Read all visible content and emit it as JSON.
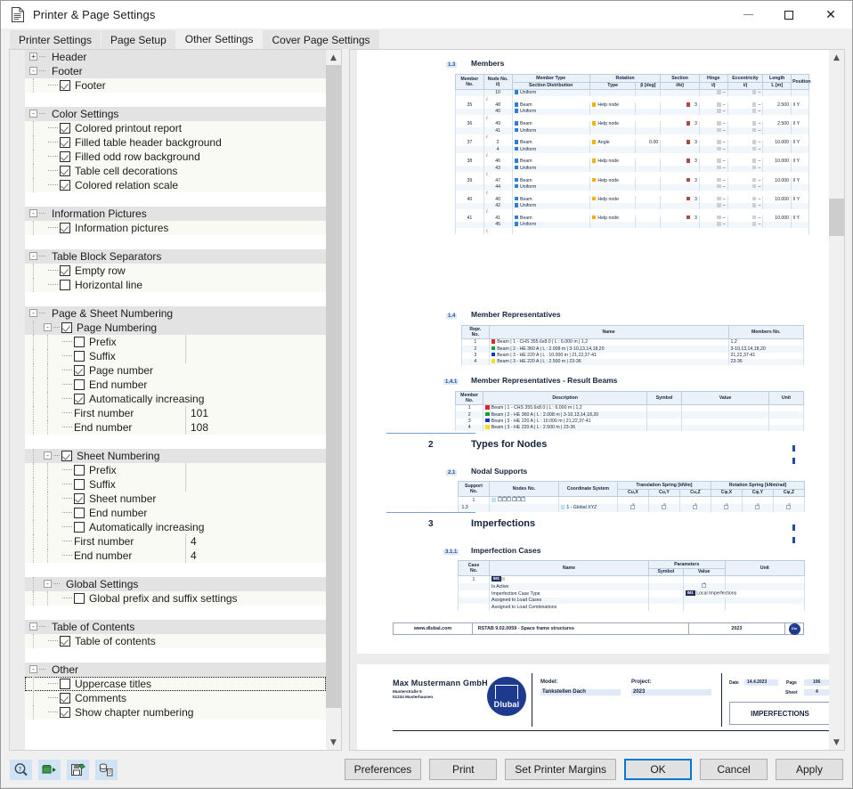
{
  "window": {
    "title": "Printer & Page Settings",
    "icon": "document-icon",
    "minimize": "minimize-icon",
    "maximize": "maximize-icon",
    "close": "close-icon"
  },
  "tabs": [
    {
      "label": "Printer Settings",
      "active": false
    },
    {
      "label": "Page Setup",
      "active": false
    },
    {
      "label": "Other Settings",
      "active": true
    },
    {
      "label": "Cover Page Settings",
      "active": false
    }
  ],
  "tree": {
    "rows": [
      {
        "kind": "group",
        "label": "Header",
        "expander": "+",
        "indent": 0
      },
      {
        "kind": "group",
        "label": "Footer",
        "expander": "-",
        "indent": 0
      },
      {
        "kind": "item",
        "label": "Footer",
        "checked": true,
        "indent": 2
      },
      {
        "kind": "blank"
      },
      {
        "kind": "group",
        "label": "Color Settings",
        "expander": "-",
        "indent": 0
      },
      {
        "kind": "item",
        "label": "Colored printout report",
        "checked": true,
        "indent": 2
      },
      {
        "kind": "item",
        "label": "Filled table header background",
        "checked": true,
        "indent": 2
      },
      {
        "kind": "item",
        "label": "Filled odd row background",
        "checked": true,
        "indent": 2
      },
      {
        "kind": "item",
        "label": "Table cell decorations",
        "checked": true,
        "indent": 2
      },
      {
        "kind": "item",
        "label": "Colored relation scale",
        "checked": true,
        "indent": 2
      },
      {
        "kind": "blank"
      },
      {
        "kind": "group",
        "label": "Information Pictures",
        "expander": "-",
        "indent": 0
      },
      {
        "kind": "item",
        "label": "Information pictures",
        "checked": true,
        "indent": 2
      },
      {
        "kind": "blank"
      },
      {
        "kind": "group",
        "label": "Table Block Separators",
        "expander": "-",
        "indent": 0
      },
      {
        "kind": "item",
        "label": "Empty row",
        "checked": true,
        "indent": 2
      },
      {
        "kind": "item",
        "label": "Horizontal line",
        "checked": false,
        "indent": 2
      },
      {
        "kind": "blank"
      },
      {
        "kind": "group",
        "label": "Page & Sheet Numbering",
        "expander": "-",
        "indent": 0
      },
      {
        "kind": "groupcb",
        "label": "Page Numbering",
        "checked": true,
        "expander": "-",
        "indent": 1
      },
      {
        "kind": "item",
        "label": "Prefix",
        "checked": false,
        "indent": 3,
        "hasvalue": true,
        "value": ""
      },
      {
        "kind": "item",
        "label": "Suffix",
        "checked": false,
        "indent": 3,
        "hasvalue": true,
        "value": ""
      },
      {
        "kind": "item",
        "label": "Page number",
        "checked": true,
        "indent": 3
      },
      {
        "kind": "item",
        "label": "End number",
        "checked": false,
        "indent": 3
      },
      {
        "kind": "item",
        "label": "Automatically increasing",
        "checked": true,
        "indent": 3
      },
      {
        "kind": "value",
        "label": "First number",
        "value": "101",
        "indent": 3
      },
      {
        "kind": "value",
        "label": "End number",
        "value": "108",
        "indent": 3
      },
      {
        "kind": "blank"
      },
      {
        "kind": "groupcb",
        "label": "Sheet Numbering",
        "checked": true,
        "expander": "-",
        "indent": 1
      },
      {
        "kind": "item",
        "label": "Prefix",
        "checked": false,
        "indent": 3,
        "hasvalue": true,
        "value": ""
      },
      {
        "kind": "item",
        "label": "Suffix",
        "checked": false,
        "indent": 3,
        "hasvalue": true,
        "value": ""
      },
      {
        "kind": "item",
        "label": "Sheet number",
        "checked": true,
        "indent": 3
      },
      {
        "kind": "item",
        "label": "End number",
        "checked": false,
        "indent": 3
      },
      {
        "kind": "item",
        "label": "Automatically increasing",
        "checked": false,
        "indent": 3
      },
      {
        "kind": "value",
        "label": "First number",
        "value": "4",
        "indent": 3
      },
      {
        "kind": "value",
        "label": "End number",
        "value": "4",
        "indent": 3
      },
      {
        "kind": "blank"
      },
      {
        "kind": "group",
        "label": "Global Settings",
        "expander": "-",
        "indent": 1
      },
      {
        "kind": "item",
        "label": "Global prefix and suffix settings",
        "checked": false,
        "indent": 3
      },
      {
        "kind": "blank"
      },
      {
        "kind": "group",
        "label": "Table of Contents",
        "expander": "-",
        "indent": 0
      },
      {
        "kind": "item",
        "label": "Table of contents",
        "checked": true,
        "indent": 2
      },
      {
        "kind": "blank"
      },
      {
        "kind": "group",
        "label": "Other",
        "expander": "-",
        "indent": 0
      },
      {
        "kind": "item",
        "label": "Uppercase titles",
        "checked": false,
        "indent": 2,
        "selected": true
      },
      {
        "kind": "item",
        "label": "Comments",
        "checked": true,
        "indent": 2
      },
      {
        "kind": "item",
        "label": "Show chapter numbering",
        "checked": true,
        "indent": 2
      }
    ],
    "scroll_up_icon": "chevron-up-icon",
    "scroll_down_icon": "chevron-down-icon"
  },
  "preview": {
    "scroll_up_icon": "chevron-up-icon",
    "scroll_down_icon": "chevron-down-icon",
    "members": {
      "chapter_no": "1.3",
      "title": "Members",
      "headers_top": [
        "Member",
        "Node No.",
        "Member Type",
        "Rotation",
        "",
        "Section",
        "Hinge",
        "Eccentricity",
        "Length",
        ""
      ],
      "headers_bottom": [
        "No.",
        "i/j",
        "Section Distribution",
        "Type",
        "β [deg]",
        "i/k/j",
        "i/j",
        "i/j",
        "L [m]",
        "Position"
      ],
      "rows": [
        {
          "no": "",
          "node": "10",
          "type": "Uniform",
          "typesw": "blue",
          "rot": "",
          "beta": "",
          "sec": "",
          "hinge": "–",
          "ecc": "–",
          "len": "",
          "pos": ""
        },
        {
          "no": "35",
          "node": "48",
          "type": "Beam",
          "typesw": "blue",
          "rot": "Help node",
          "beta": "",
          "sec": "3",
          "hinge": "–",
          "ecc": "–",
          "len": "2.500",
          "pos": "Y"
        },
        {
          "no": "",
          "node": "40",
          "type": "Uniform",
          "typesw": "blue",
          "rot": "",
          "beta": "",
          "sec": "",
          "hinge": "–",
          "ecc": "–",
          "len": "",
          "pos": ""
        },
        {
          "no": "36",
          "node": "49",
          "type": "Beam",
          "typesw": "blue",
          "rot": "Help node",
          "beta": "",
          "sec": "3",
          "hinge": "–",
          "ecc": "–",
          "len": "2.500",
          "pos": "Y"
        },
        {
          "no": "",
          "node": "41",
          "type": "Uniform",
          "typesw": "blue",
          "rot": "",
          "beta": "",
          "sec": "",
          "hinge": "–",
          "ecc": "–",
          "len": "",
          "pos": ""
        },
        {
          "no": "37",
          "node": "2",
          "type": "Beam",
          "typesw": "blue",
          "rot": "Angle",
          "beta": "0.00",
          "sec": "3",
          "hinge": "–",
          "ecc": "–",
          "len": "10.000",
          "pos": "Y"
        },
        {
          "no": "",
          "node": "4",
          "type": "Uniform",
          "typesw": "blue",
          "rot": "",
          "beta": "",
          "sec": "",
          "hinge": "–",
          "ecc": "–",
          "len": "",
          "pos": ""
        },
        {
          "no": "38",
          "node": "46",
          "type": "Beam",
          "typesw": "blue",
          "rot": "Help node",
          "beta": "",
          "sec": "3",
          "hinge": "–",
          "ecc": "–",
          "len": "10.000",
          "pos": "Y"
        },
        {
          "no": "",
          "node": "43",
          "type": "Uniform",
          "typesw": "blue",
          "rot": "",
          "beta": "",
          "sec": "",
          "hinge": "–",
          "ecc": "–",
          "len": "",
          "pos": ""
        },
        {
          "no": "39",
          "node": "47",
          "type": "Beam",
          "typesw": "blue",
          "rot": "Help node",
          "beta": "",
          "sec": "3",
          "hinge": "–",
          "ecc": "–",
          "len": "10.000",
          "pos": "Y"
        },
        {
          "no": "",
          "node": "44",
          "type": "Uniform",
          "typesw": "blue",
          "rot": "",
          "beta": "",
          "sec": "",
          "hinge": "–",
          "ecc": "–",
          "len": "",
          "pos": ""
        },
        {
          "no": "40",
          "node": "40",
          "type": "Beam",
          "typesw": "blue",
          "rot": "Help node",
          "beta": "",
          "sec": "3",
          "hinge": "–",
          "ecc": "–",
          "len": "10.000",
          "pos": "Y"
        },
        {
          "no": "",
          "node": "42",
          "type": "Uniform",
          "typesw": "blue",
          "rot": "",
          "beta": "",
          "sec": "",
          "hinge": "–",
          "ecc": "–",
          "len": "",
          "pos": ""
        },
        {
          "no": "41",
          "node": "41",
          "type": "Beam",
          "typesw": "blue",
          "rot": "Help node",
          "beta": "",
          "sec": "3",
          "hinge": "–",
          "ecc": "–",
          "len": "10.000",
          "pos": "Y"
        },
        {
          "no": "",
          "node": "45",
          "type": "Uniform",
          "typesw": "blue",
          "rot": "",
          "beta": "",
          "sec": "",
          "hinge": "–",
          "ecc": "–",
          "len": "",
          "pos": ""
        }
      ]
    },
    "member_representatives": {
      "chapter_no": "1.4",
      "title": "Member Representatives",
      "headers": [
        "Repr. No.",
        "Name",
        "Members No."
      ],
      "rows": [
        {
          "no": "1",
          "color": "r1",
          "name": "Beam | 1 - CHS 355.6x8.0 | L : 6.000 m | 1,2",
          "members": "1,2"
        },
        {
          "no": "2",
          "color": "g1",
          "name": "Beam | 2 - HE 360 A | L : 2.008 m | 3-10,13,14,18,20",
          "members": "3-10,13,14,18,20"
        },
        {
          "no": "3",
          "color": "b1",
          "name": "Beam | 3 - HE 220 A | L : 10.000 m | 21,22,37-41",
          "members": "21,22,37-41"
        },
        {
          "no": "4",
          "color": "y1",
          "name": "Beam | 3 - HE 220 A | L : 2.500 m | 23-36",
          "members": "23-36"
        }
      ]
    },
    "result_beams": {
      "chapter_no": "1.4.1",
      "title": "Member Representatives - Result Beams",
      "headers": [
        "Member No.",
        "Description",
        "Symbol",
        "Value",
        "Unit"
      ],
      "rows": [
        {
          "no": "1",
          "color": "r1",
          "desc": "Beam | 1 - CHS 355.6x8.0 | L : 6.000 m | 1,2",
          "symbol": "",
          "value": "",
          "unit": ""
        },
        {
          "no": "2",
          "color": "g1",
          "desc": "Beam | 2 - HE 360 A | L : 2.008 m | 3-10,13,14,18,20",
          "symbol": "",
          "value": "",
          "unit": ""
        },
        {
          "no": "3",
          "color": "b1",
          "desc": "Beam | 3 - HE 220 A | L : 10.000 m | 21,22,37-41",
          "symbol": "",
          "value": "",
          "unit": ""
        },
        {
          "no": "4",
          "color": "y1",
          "desc": "Beam | 3 - HE 220 A | L : 2.500 m | 23-36",
          "symbol": "",
          "value": "",
          "unit": ""
        }
      ]
    },
    "types_for_nodes": {
      "chapter_no": "2",
      "title": "Types for Nodes"
    },
    "nodal_supports": {
      "chapter_no": "2.1",
      "title": "Nodal Supports",
      "headers_top": [
        "Support",
        "Nodes No.",
        "Coordinate System",
        "Translation Spring [kN/m]",
        "Rotation Spring [kNm/rad]"
      ],
      "headers_bottom": [
        "No.",
        "",
        "",
        "Cu,X",
        "Cu,Y",
        "Cu,Z",
        "Cφ,X",
        "Cφ,Y",
        "Cφ,Z"
      ],
      "rows": [
        {
          "no": "1",
          "nodes": "",
          "cs": ""
        },
        {
          "no": "",
          "nodes": "1,3",
          "cs": "1 - Global XYZ"
        }
      ]
    },
    "imperfections": {
      "chapter_no": "3",
      "title": "Imperfections"
    },
    "imperfection_cases": {
      "chapter_no": "3.1.1",
      "title": "Imperfection Cases",
      "headers_top": [
        "Case",
        "",
        "Parameters",
        "",
        ""
      ],
      "headers_bottom": [
        "No.",
        "Name",
        "Symbol",
        "Value",
        "Unit"
      ],
      "rows": [
        {
          "no": "1",
          "name": "IM1",
          "tag": true,
          "symbol": "",
          "value": "",
          "unit": ""
        },
        {
          "no": "",
          "name": "Is Active",
          "symbol": "",
          "value": "x",
          "unit": ""
        },
        {
          "no": "",
          "name": "Imperfection Case Type",
          "symbol": "",
          "value": "Local Imperfections",
          "valuetag": true,
          "unit": ""
        },
        {
          "no": "",
          "name": "Assigned to Load Cases",
          "symbol": "",
          "value": "",
          "unit": ""
        },
        {
          "no": "",
          "name": "Assigned to Load Combinations",
          "symbol": "",
          "value": "",
          "unit": ""
        }
      ]
    },
    "page_footer": {
      "website": "www.dlubal.com",
      "program": "RSTAB 9.02.0059 - Space frame structures",
      "year": "2023",
      "logo": "dlubal-logo"
    },
    "page_header": {
      "company": "Max Mustermann GmbH",
      "street": "Musterstraße 5",
      "city": "01234 Musterhausen",
      "logo_text": "Dlubal",
      "model_label": "Model:",
      "model_value": "Tankstellen Dach",
      "project_label": "Project:",
      "project_value": "2023",
      "date_label": "Date",
      "date_value": "14.4.2023",
      "page_label": "Page",
      "page_value": "106",
      "sheet_label": "Sheet",
      "sheet_value": "4",
      "section_title": "IMPERFECTIONS"
    }
  },
  "toolbar": [
    {
      "icon": "zoom-search-icon"
    },
    {
      "icon": "import-settings-icon"
    },
    {
      "icon": "save-settings-icon"
    },
    {
      "icon": "database-document-icon"
    }
  ],
  "buttons": {
    "preferences": "Preferences",
    "print": "Print",
    "set_printer_margins": "Set Printer Margins",
    "ok": "OK",
    "cancel": "Cancel",
    "apply": "Apply"
  },
  "colors": {
    "accent": "#0078d7",
    "tree_group_bg": "#e3e3e3",
    "tree_item_bg": "#fafaf5",
    "toolbtn_bg": "#cfe3f5",
    "report_blue": "#1f4e9c"
  }
}
